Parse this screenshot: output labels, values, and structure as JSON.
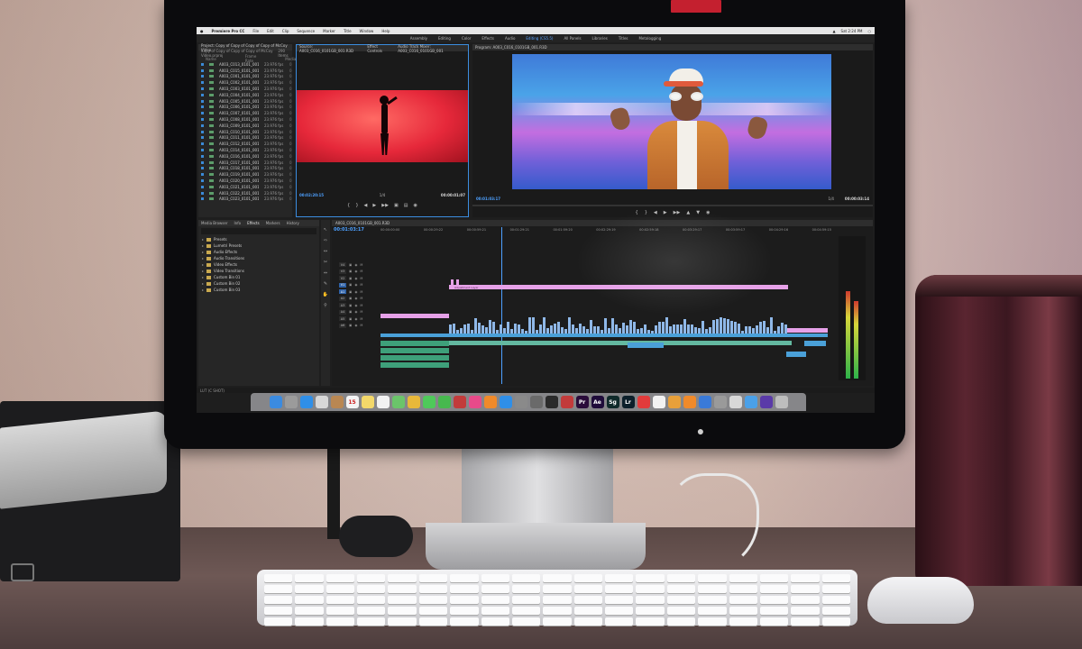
{
  "menubar": {
    "app_name": "Premiere Pro CC",
    "items": [
      "File",
      "Edit",
      "Clip",
      "Sequence",
      "Marker",
      "Title",
      "Window",
      "Help"
    ],
    "clock": "Sat 2:24 PM"
  },
  "workspaces": [
    "Assembly",
    "Editing",
    "Color",
    "Effects",
    "Audio",
    "Editing (CS5.5)",
    "All Panels",
    "Libraries",
    "Titles",
    "Metalogging"
  ],
  "project_panel": {
    "title": "Project: Copy of Copy of Copy of Copy of McCoy Video",
    "path": "Copy of Copy of Copy of Copy of McCoy Video.prproj",
    "item_count": "290 Items",
    "columns": [
      "Name",
      "Frame Rate",
      "Media"
    ],
    "clips": [
      {
        "name": "A003_C013_0101_001",
        "fps": "23.976 fps",
        "media": "0"
      },
      {
        "name": "A003_C015_0101_001",
        "fps": "23.976 fps",
        "media": "0"
      },
      {
        "name": "A003_C001_0101_001",
        "fps": "23.976 fps",
        "media": "0"
      },
      {
        "name": "A003_C002_0101_001",
        "fps": "23.976 fps",
        "media": "0"
      },
      {
        "name": "A003_C003_0101_001",
        "fps": "23.976 fps",
        "media": "0"
      },
      {
        "name": "A003_C004_0101_001",
        "fps": "23.976 fps",
        "media": "0"
      },
      {
        "name": "A003_C005_0101_001",
        "fps": "23.976 fps",
        "media": "0"
      },
      {
        "name": "A003_C006_0101_001",
        "fps": "23.976 fps",
        "media": "0"
      },
      {
        "name": "A003_C007_0101_001",
        "fps": "23.976 fps",
        "media": "0"
      },
      {
        "name": "A003_C008_0101_001",
        "fps": "23.976 fps",
        "media": "0"
      },
      {
        "name": "A003_C009_0101_001",
        "fps": "23.976 fps",
        "media": "0"
      },
      {
        "name": "A003_C010_0101_001",
        "fps": "23.976 fps",
        "media": "0"
      },
      {
        "name": "A003_C011_0101_001",
        "fps": "23.976 fps",
        "media": "0"
      },
      {
        "name": "A003_C012_0101_001",
        "fps": "23.976 fps",
        "media": "0"
      },
      {
        "name": "A003_C014_0101_001",
        "fps": "23.976 fps",
        "media": "0"
      },
      {
        "name": "A003_C016_0101_001",
        "fps": "23.976 fps",
        "media": "0"
      },
      {
        "name": "A003_C017_0101_001",
        "fps": "23.976 fps",
        "media": "0"
      },
      {
        "name": "A003_C018_0101_001",
        "fps": "23.976 fps",
        "media": "0"
      },
      {
        "name": "A003_C019_0101_001",
        "fps": "23.976 fps",
        "media": "0"
      },
      {
        "name": "A003_C020_0101_001",
        "fps": "23.976 fps",
        "media": "0"
      },
      {
        "name": "A003_C021_0101_001",
        "fps": "23.976 fps",
        "media": "0"
      },
      {
        "name": "A003_C022_0101_001",
        "fps": "23.976 fps",
        "media": "0"
      },
      {
        "name": "A003_C023_0101_001",
        "fps": "23.976 fps",
        "media": "0"
      }
    ]
  },
  "source_monitor": {
    "tabs": [
      "Source: A003_C016_0101GB_001.R3D",
      "Effect Controls",
      "Audio Track Mixer: A003_C016_0101GB_001"
    ],
    "timecode_in": "00:02:20:15",
    "fit": "1/4",
    "timecode_out": "00:00:01:07"
  },
  "program_monitor": {
    "tab": "Program: A003_C016_0101GB_001.R3D",
    "timecode_in": "00:01:03:17",
    "fit": "1/4",
    "timecode_out": "00:00:03:14"
  },
  "effects_panel": {
    "tabs": [
      "Media Browser",
      "Info",
      "Effects",
      "Markers",
      "History"
    ],
    "items": [
      "Presets",
      "Lumetri Presets",
      "Audio Effects",
      "Audio Transitions",
      "Video Effects",
      "Video Transitions",
      "Custom Bin 01",
      "Custom Bin 02",
      "Custom Bin 03"
    ]
  },
  "timeline": {
    "sequence_tab": "A003_C016_0101GB_001.R3D",
    "timecode": "00:01:03:17",
    "ruler": [
      "00:00:00:00",
      "00:00:29:22",
      "00:00:59:21",
      "00:01:29:21",
      "00:01:59:20",
      "00:02:29:19",
      "00:02:59:18",
      "00:03:29:17",
      "00:03:59:17",
      "00:04:29:16",
      "00:04:59:15"
    ],
    "tracks": [
      "V4",
      "V3",
      "V2",
      "V1",
      "A1",
      "A2",
      "A3",
      "A4",
      "A5",
      "A6"
    ],
    "adjustment_label": "Adjustment Layer"
  },
  "statusbar": {
    "text": "LUT (C SHOT)"
  },
  "dock": {
    "apps": [
      {
        "name": "finder-icon",
        "label": "",
        "color": "#3b8be0"
      },
      {
        "name": "launchpad-icon",
        "label": "",
        "color": "#9b9b9b"
      },
      {
        "name": "safari-icon",
        "label": "",
        "color": "#2f8fe8"
      },
      {
        "name": "mail-icon",
        "label": "",
        "color": "#d8d8d8"
      },
      {
        "name": "contacts-icon",
        "label": "",
        "color": "#b98752"
      },
      {
        "name": "calendar-icon",
        "label": "15",
        "color": "#f4f4f4"
      },
      {
        "name": "notes-icon",
        "label": "",
        "color": "#f3d86a"
      },
      {
        "name": "reminders-icon",
        "label": "",
        "color": "#f2f2f2"
      },
      {
        "name": "maps-icon",
        "label": "",
        "color": "#6bc46a"
      },
      {
        "name": "photos-icon",
        "label": "",
        "color": "#e8b83a"
      },
      {
        "name": "messages-icon",
        "label": "",
        "color": "#4fc95a"
      },
      {
        "name": "facetime-icon",
        "label": "",
        "color": "#47b84e"
      },
      {
        "name": "photo-booth-icon",
        "label": "",
        "color": "#c23b3b"
      },
      {
        "name": "itunes-icon",
        "label": "",
        "color": "#e84a8a"
      },
      {
        "name": "ibooks-icon",
        "label": "",
        "color": "#f08a2a"
      },
      {
        "name": "app-store-icon",
        "label": "",
        "color": "#2f8fe8"
      },
      {
        "name": "preferences-icon",
        "label": "",
        "color": "#8a8a8a"
      },
      {
        "name": "chess-icon",
        "label": "",
        "color": "#6a6a6a"
      },
      {
        "name": "dvd-player-icon",
        "label": "",
        "color": "#2a2a2a"
      },
      {
        "name": "music-icon",
        "label": "",
        "color": "#c23b3b"
      },
      {
        "name": "premiere-icon",
        "label": "Pr",
        "color": "#2a0c3a"
      },
      {
        "name": "after-effects-icon",
        "label": "Ae",
        "color": "#1f0c3a"
      },
      {
        "name": "speedgrade-icon",
        "label": "Sg",
        "color": "#0f2a2a"
      },
      {
        "name": "lightroom-icon",
        "label": "Lr",
        "color": "#0c1f2a"
      },
      {
        "name": "creative-cloud-icon",
        "label": "",
        "color": "#e23b3b"
      },
      {
        "name": "itunes-2-icon",
        "label": "",
        "color": "#f2f2f2"
      },
      {
        "name": "cyberduck-icon",
        "label": "",
        "color": "#e8a03a"
      },
      {
        "name": "vlc-icon",
        "label": "",
        "color": "#f08a2a"
      },
      {
        "name": "app-blue-icon",
        "label": "",
        "color": "#3a7ad8"
      },
      {
        "name": "image-capture-icon",
        "label": "",
        "color": "#9a9a9a"
      },
      {
        "name": "script-icon",
        "label": "",
        "color": "#d8d8d8"
      },
      {
        "name": "folder-icon",
        "label": "",
        "color": "#4aa0e8"
      },
      {
        "name": "app-purple-icon",
        "label": "",
        "color": "#5a3aa8"
      },
      {
        "name": "trash-icon",
        "label": "",
        "color": "#bdbdbd"
      }
    ]
  }
}
